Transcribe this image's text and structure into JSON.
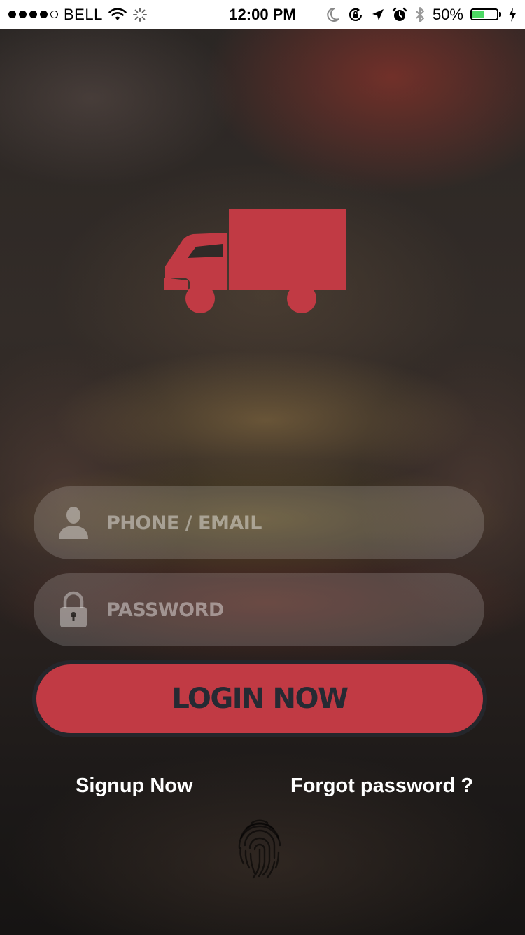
{
  "status_bar": {
    "carrier": "BELL",
    "time": "12:00 PM",
    "battery_percent": "50%",
    "battery_level": 0.5,
    "signal_bars_filled": 4,
    "signal_bars_total": 5,
    "icons": [
      "wifi-icon",
      "activity-spinner-icon",
      "moon-icon",
      "rotation-lock-icon",
      "location-arrow-icon",
      "alarm-icon",
      "bluetooth-icon",
      "charging-bolt-icon"
    ]
  },
  "logo": {
    "icon": "delivery-truck-icon",
    "color": "#c13a44"
  },
  "login_form": {
    "phone_email": {
      "placeholder": "PHONE / EMAIL",
      "value": "",
      "icon": "user-icon"
    },
    "password": {
      "placeholder": "PASSWORD",
      "value": "",
      "icon": "lock-icon"
    },
    "login_button_label": "LOGIN NOW"
  },
  "links": {
    "signup": "Signup Now",
    "forgot_password": "Forgot password ?"
  },
  "fingerprint": {
    "icon": "fingerprint-icon"
  },
  "colors": {
    "accent": "#c13a44",
    "button_text": "#262a33",
    "status_bar_bg": "#ffffff",
    "battery_fill": "#4cd964"
  }
}
